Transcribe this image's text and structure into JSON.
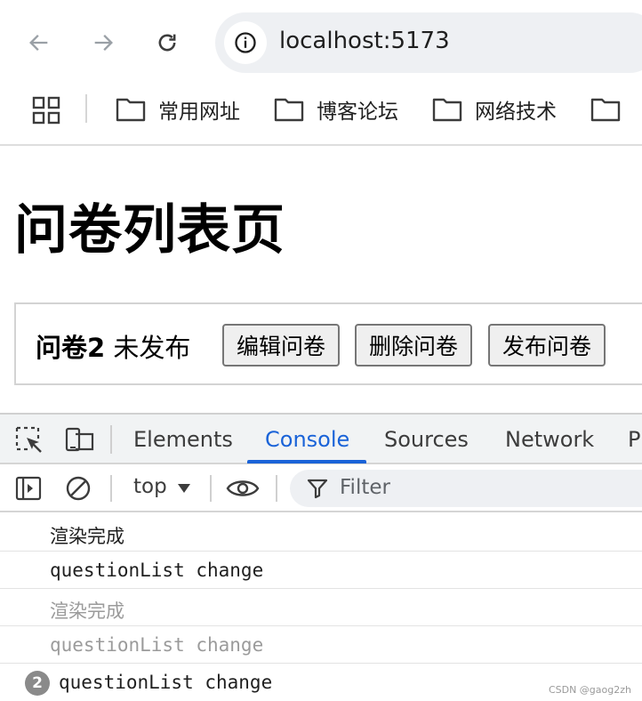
{
  "browser": {
    "url": "localhost:5173",
    "icons": [
      "back-arrow-icon",
      "forward-arrow-icon",
      "reload-icon",
      "site-info-icon"
    ]
  },
  "bookmarks": {
    "items": [
      {
        "label": "常用网址",
        "icon": "folder-icon"
      },
      {
        "label": "博客论坛",
        "icon": "folder-icon"
      },
      {
        "label": "网络技术",
        "icon": "folder-icon"
      },
      {
        "label": "",
        "icon": "folder-icon"
      }
    ]
  },
  "page": {
    "title": "问卷列表页",
    "question": {
      "name": "问卷2",
      "status": "未发布",
      "buttons": {
        "edit": "编辑问卷",
        "delete": "删除问卷",
        "publish": "发布问卷"
      }
    }
  },
  "devtools": {
    "tabs": [
      "Elements",
      "Console",
      "Sources",
      "Network",
      "P"
    ],
    "active_tab": "Console",
    "context": "top",
    "filter_placeholder": "Filter",
    "accent_color": "#1a63d8",
    "logs": [
      {
        "text": "渲染完成",
        "style": "normal"
      },
      {
        "text": "questionList change",
        "style": "normal"
      },
      {
        "text": "渲染完成",
        "style": "faded"
      },
      {
        "text": "questionList change",
        "style": "faded"
      },
      {
        "text": "questionList change",
        "style": "normal",
        "count": "2"
      }
    ]
  },
  "watermark": "CSDN @gaog2zh"
}
